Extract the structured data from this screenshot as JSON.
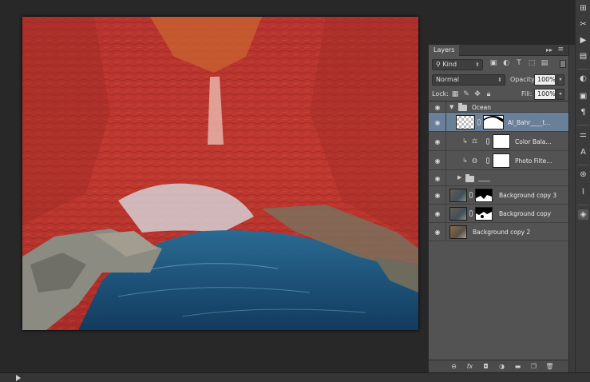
{
  "layers_panel": {
    "tab_title": "Layers",
    "kind_filter": "Kind",
    "blend_mode": "Normal",
    "opacity_label": "Opacity:",
    "opacity_value": "100%",
    "lock_label": "Lock:",
    "fill_label": "Fill:",
    "fill_value": "100%",
    "layers": [
      {
        "name": "Ocean",
        "type": "group",
        "expanded": true,
        "selected": false
      },
      {
        "name": "Al_Bahr____t...",
        "type": "smart-object",
        "selected": true
      },
      {
        "name": "Color Bala...",
        "type": "adjustment",
        "clipped": true
      },
      {
        "name": "Photo Filte...",
        "type": "adjustment",
        "clipped": true
      },
      {
        "name": "____",
        "type": "group",
        "expanded": false
      },
      {
        "name": "Background copy 3",
        "type": "masked-layer"
      },
      {
        "name": "Background copy",
        "type": "masked-layer"
      },
      {
        "name": "Background copy 2",
        "type": "layer"
      }
    ],
    "footer_icons": [
      "link-icon",
      "fx-icon",
      "mask-icon",
      "adjustment-icon",
      "folder-icon",
      "new-layer-icon",
      "trash-icon"
    ]
  },
  "icons": {
    "right_strip": [
      "history-icon",
      "tools-icon",
      "play-icon",
      "info-icon",
      "brush-icon",
      "clone-icon",
      "text-icon",
      "adjust-icon",
      "paths-icon",
      "channels-icon",
      "layers-icon"
    ]
  },
  "colors": {
    "selection_highlight": "#6a7f98",
    "panel_bg": "#535353",
    "workspace_bg": "#282828",
    "red_overlay": "#c42d2a",
    "water": "#1d4d72"
  }
}
